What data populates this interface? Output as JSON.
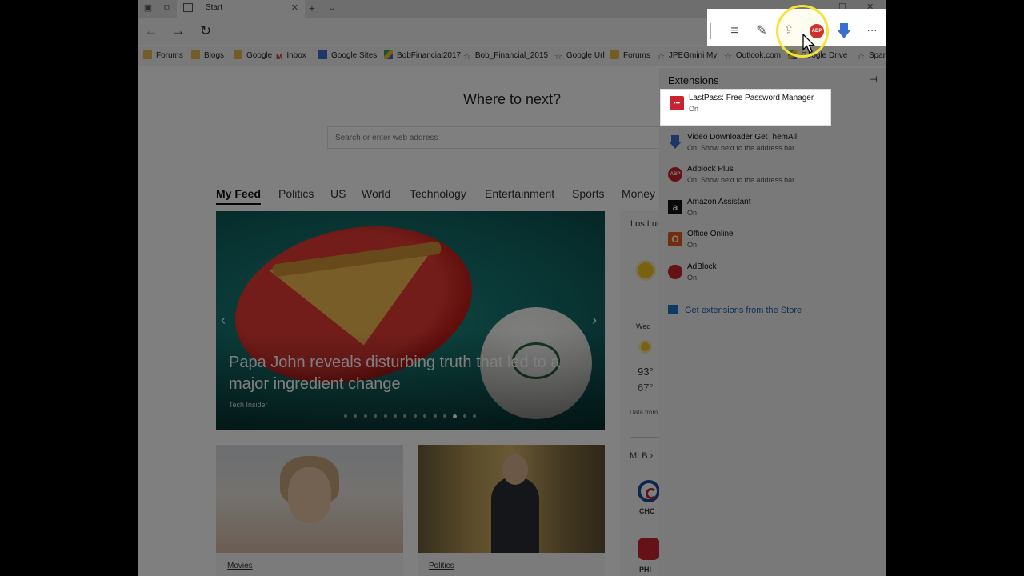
{
  "browser": {
    "tab": {
      "title": "Start",
      "close": "✕"
    },
    "tabstrip_icons": [
      "tabs-icon",
      "set-aside-icon"
    ],
    "new_tab": "+",
    "tab_menu": "⌄",
    "window_controls": {
      "minimize": "–",
      "maximize": "☐",
      "close": "✕"
    },
    "nav": {
      "back": "←",
      "forward": "→",
      "refresh": "↻"
    }
  },
  "favorites": [
    {
      "label": "Forums",
      "icon": "folder"
    },
    {
      "label": "Blogs",
      "icon": "folder"
    },
    {
      "label": "Google",
      "icon": "folder"
    },
    {
      "label": "Inbox",
      "icon": "gmail"
    },
    {
      "label": "Google Sites",
      "icon": "gsite"
    },
    {
      "label": "BobFinancial2017",
      "icon": "gdrive"
    },
    {
      "label": "Bob_Financial_2015",
      "icon": "star"
    },
    {
      "label": "Google Url",
      "icon": "star"
    },
    {
      "label": "Forums",
      "icon": "folder"
    },
    {
      "label": "JPEGmini",
      "icon": "star"
    },
    {
      "label": "My",
      "icon": "none"
    },
    {
      "label": "Outlook.com",
      "icon": "star"
    },
    {
      "label": "Google Drive",
      "icon": "gdrive"
    },
    {
      "label": "Spar",
      "icon": "star"
    }
  ],
  "page": {
    "heading": "Where to next?",
    "search_placeholder": "Search or enter web address",
    "feed_tabs": [
      "My Feed",
      "Politics",
      "US",
      "World",
      "Technology",
      "Entertainment",
      "Sports",
      "Money"
    ],
    "active_feed_tab": "My Feed",
    "hero": {
      "title": "Papa John reveals disturbing truth that led to a major ingredient change",
      "source": "Tech Insider",
      "prev": "‹",
      "next": "›",
      "slide_count": 14,
      "active_slide": 11
    },
    "cards": [
      {
        "category": "Movies"
      },
      {
        "category": "Politics"
      }
    ],
    "weather": {
      "location": "Los Lun",
      "day": "Wed",
      "high": "93°",
      "low": "67°",
      "source": "Data from"
    },
    "sports": {
      "league": "MLB ›",
      "teams": [
        "CHC",
        "PHI"
      ]
    }
  },
  "toolbar": {
    "hub": "≡",
    "notes": "✎",
    "share": "⇪",
    "abp_badge": "ABP",
    "more": "···"
  },
  "extensions_panel": {
    "title": "Extensions",
    "pin": "⊣",
    "items": [
      {
        "name": "LastPass: Free Password Manager",
        "status": "On",
        "icon": "lastpass-icon",
        "glyph": "•••"
      },
      {
        "name": "Video Downloader GetThemAll",
        "status": "On: Show next to the address bar",
        "icon": "video-downloader-icon",
        "glyph": ""
      },
      {
        "name": "Adblock Plus",
        "status": "On: Show next to the address bar",
        "icon": "adblock-plus-icon",
        "glyph": "ABP"
      },
      {
        "name": "Amazon Assistant",
        "status": "On",
        "icon": "amazon-icon",
        "glyph": "a"
      },
      {
        "name": "Office Online",
        "status": "On",
        "icon": "office-icon",
        "glyph": "O"
      },
      {
        "name": "AdBlock",
        "status": "On",
        "icon": "adblock-icon",
        "glyph": ""
      }
    ],
    "store_link": "Get extensions from the Store"
  },
  "colors": {
    "accent_link": "#1a5fb4",
    "abp_red": "#c8242f",
    "highlight_ring": "#f5e23a",
    "overlay": "rgba(0,0,0,0.5)"
  }
}
